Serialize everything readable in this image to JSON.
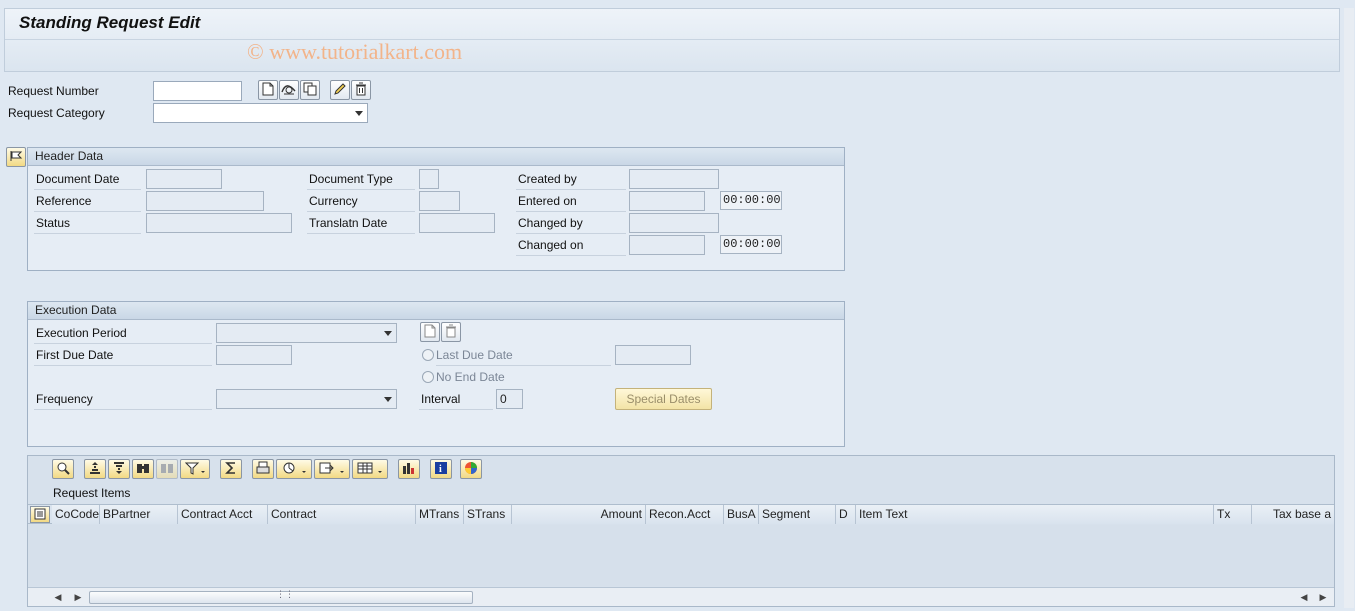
{
  "window": {
    "title": "Standing Request Edit",
    "watermark": "© www.tutorialkart.com"
  },
  "request": {
    "number_label": "Request Number",
    "number_value": "",
    "category_label": "Request Category",
    "category_value": ""
  },
  "header": {
    "title": "Header Data",
    "document_date_label": "Document Date",
    "reference_label": "Reference",
    "status_label": "Status",
    "document_type_label": "Document Type",
    "currency_label": "Currency",
    "translatn_date_label": "Translatn Date",
    "created_by_label": "Created by",
    "entered_on_label": "Entered on",
    "entered_on_time": "00:00:00",
    "changed_by_label": "Changed by",
    "changed_on_label": "Changed on",
    "changed_on_time": "00:00:00"
  },
  "execution": {
    "title": "Execution Data",
    "period_label": "Execution Period",
    "first_due_label": "First Due Date",
    "last_due_label": "Last Due Date",
    "no_end_label": "No End Date",
    "frequency_label": "Frequency",
    "interval_label": "Interval",
    "interval_value": "0",
    "special_dates_label": "Special Dates"
  },
  "items": {
    "title": "Request Items",
    "columns": [
      "CoCode",
      "BPartner",
      "Contract Acct",
      "Contract",
      "MTrans",
      "STrans",
      "Amount",
      "Recon.Acct",
      "BusA",
      "Segment",
      "D",
      "Item Text",
      "Tx",
      "Tax base a"
    ]
  },
  "icons": {
    "request_toolbar": [
      "new-document-icon",
      "display-icon",
      "copy-icon",
      "edit-pencil-icon",
      "delete-trash-icon"
    ],
    "grid_toolbar": [
      "details-icon",
      "sort-ascending-icon",
      "sort-descending-icon",
      "find-icon",
      "find-next-icon",
      "filter-icon",
      "sum-icon",
      "print-icon",
      "views-icon",
      "export-icon",
      "layout-icon",
      "graphic-icon",
      "info-icon",
      "colors-icon"
    ]
  }
}
